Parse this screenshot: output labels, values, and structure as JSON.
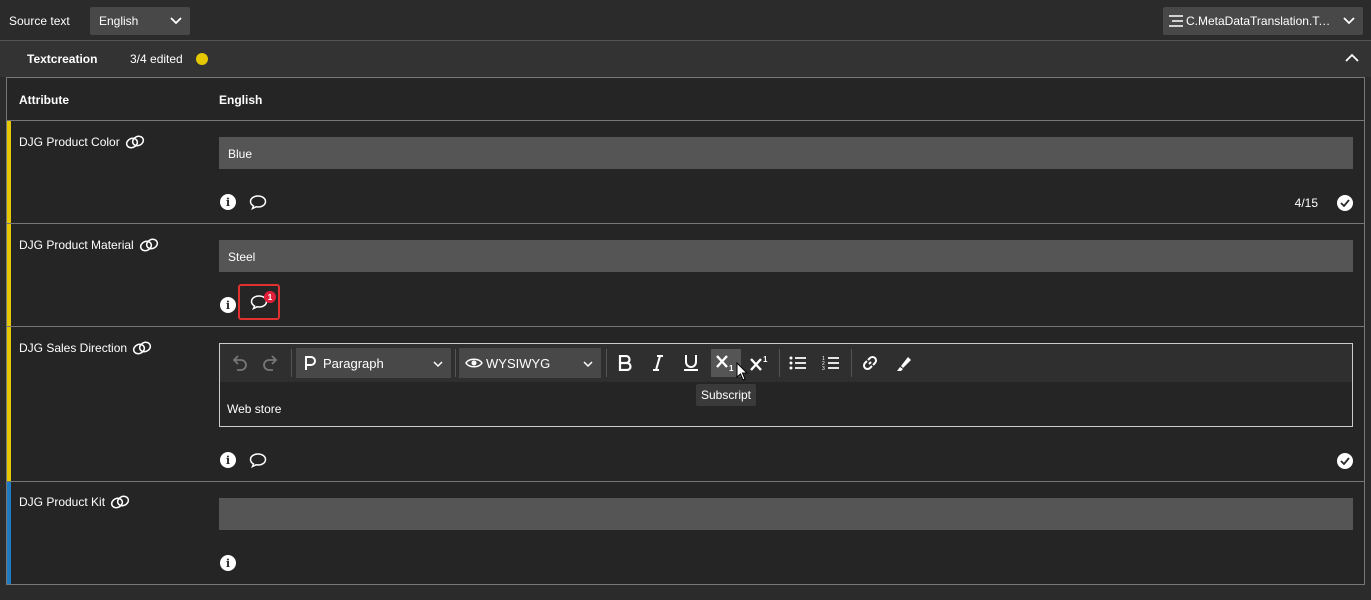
{
  "topbar": {
    "source_label": "Source text",
    "source_value": "English",
    "context_value": "C.MetaDataTranslation.Te…"
  },
  "section": {
    "title": "Textcreation",
    "count": "3/4 edited",
    "status_color": "#e5c800"
  },
  "table": {
    "col_attribute": "Attribute",
    "col_language": "English"
  },
  "rows": [
    {
      "label": "DJG Product Color",
      "value": "Blue",
      "charcount": "4/15",
      "bar_color": "#e5c800"
    },
    {
      "label": "DJG Product Material",
      "value": "Steel",
      "comment_badge": "1",
      "bar_color": "#e5c800"
    },
    {
      "label": "DJG Sales Direction",
      "bar_color": "#e5c800",
      "editor": {
        "paragraph": "Paragraph",
        "mode": "WYSIWYG",
        "content": "Web store",
        "tooltip": "Subscript"
      }
    },
    {
      "label": "DJG Product Kit",
      "value": "",
      "bar_color": "#1f7bc1"
    }
  ]
}
